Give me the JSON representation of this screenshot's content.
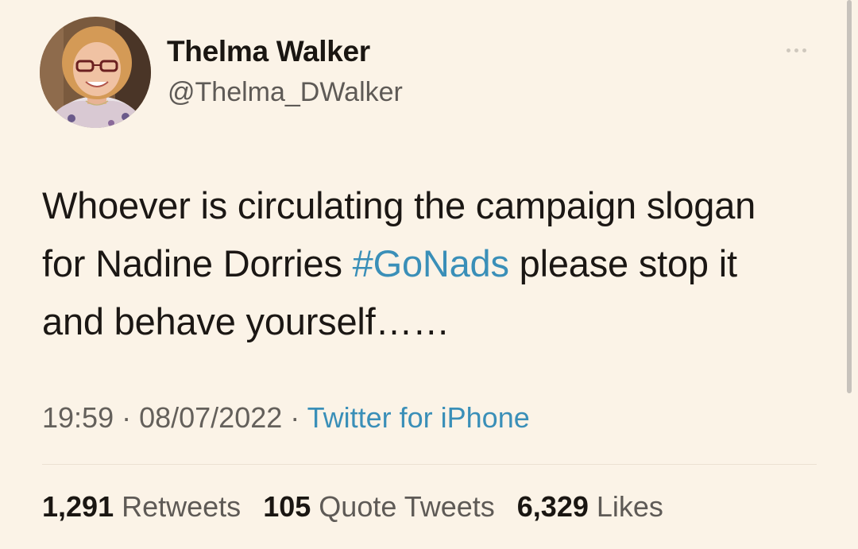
{
  "user": {
    "display_name": "Thelma Walker",
    "handle": "@Thelma_DWalker"
  },
  "tweet": {
    "text_before_hashtag": "Whoever is circulating the campaign slogan for Nadine Dorries ",
    "hashtag": "#GoNads",
    "text_after_hashtag": " please stop it and behave yourself……"
  },
  "meta": {
    "time": "19:59",
    "separator": " · ",
    "date": "08/07/2022",
    "source": "Twitter for iPhone"
  },
  "stats": {
    "retweets_count": "1,291",
    "retweets_label": "Retweets",
    "quotes_count": "105",
    "quotes_label": "Quote Tweets",
    "likes_count": "6,329",
    "likes_label": "Likes"
  },
  "colors": {
    "background": "#fbf3e7",
    "link": "#3a8fb8",
    "text": "#1b1714",
    "muted": "#64605b"
  },
  "icons": {
    "more": "more-horizontal-icon"
  }
}
